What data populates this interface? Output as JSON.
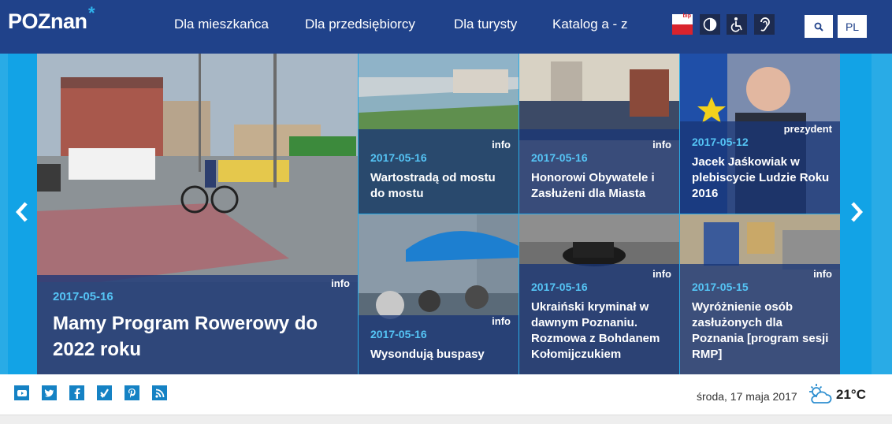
{
  "header": {
    "logo_text": "POZnan",
    "logo_star": "*",
    "nav": [
      "Dla mieszkańca",
      "Dla przedsiębiorcy",
      "Dla turysty",
      "Katalog a - z"
    ],
    "bip_label": "bip",
    "search_icon": "search-icon",
    "lang": "PL"
  },
  "slider": {
    "prev_icon": "chevron-left-icon",
    "next_icon": "chevron-right-icon",
    "main": {
      "tag": "info",
      "date": "2017-05-16",
      "title": "Mamy Program Rowerowy do 2022 roku"
    },
    "tiles": [
      {
        "tag": "info",
        "date": "2017-05-16",
        "title": "Wartostradą od mostu do mostu"
      },
      {
        "tag": "info",
        "date": "2017-05-16",
        "title": "Honorowi Obywatele i Zasłużeni dla Miasta"
      },
      {
        "tag": "prezydent",
        "date": "2017-05-12",
        "title": "Jacek Jaśkowiak w plebiscycie Ludzie Roku 2016"
      },
      {
        "tag": "info",
        "date": "2017-05-16",
        "title": "Wysondują buspasy"
      },
      {
        "tag": "info",
        "date": "2017-05-16",
        "title": "Ukraiński kryminał w dawnym Poznaniu. Rozmowa z Bohdanem Kołomijczukiem"
      },
      {
        "tag": "info",
        "date": "2017-05-15",
        "title": "Wyróżnienie osób zasłużonych dla Poznania [program sesji RMP]"
      }
    ]
  },
  "footer": {
    "social": [
      "youtube-icon",
      "twitter-icon",
      "facebook-icon",
      "foursquare-icon",
      "pinterest-icon",
      "rss-icon"
    ],
    "date": "środa, 17 maja 2017",
    "weather_icon": "partly-cloudy-icon",
    "temperature": "21°C"
  },
  "colors": {
    "header_bg": "#20428a",
    "slider_bg": "#29abe6",
    "overlay": "#193676",
    "date_accent": "#55c4f5",
    "social": "#1582c4"
  }
}
